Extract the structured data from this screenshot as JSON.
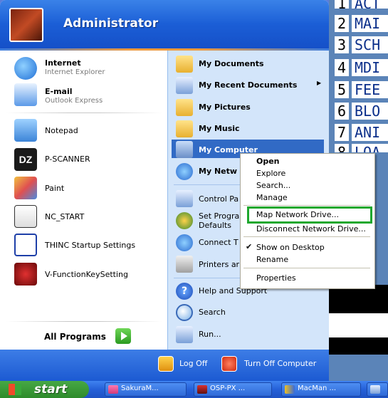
{
  "background_app": {
    "rows": [
      {
        "num": "1",
        "word": "ACT"
      },
      {
        "num": "2",
        "word": "MAI"
      },
      {
        "num": "3",
        "word": "SCH"
      },
      {
        "num": "4",
        "word": "MDI"
      },
      {
        "num": "5",
        "word": "FEE"
      },
      {
        "num": "6",
        "word": "BLO"
      },
      {
        "num": "7",
        "word": "ANI"
      },
      {
        "num": "8",
        "word": "LOA"
      }
    ]
  },
  "start_menu": {
    "user_name": "Administrator",
    "pinned": [
      {
        "label": "Internet",
        "sub": "Internet Explorer",
        "icon": "internet-explorer-icon"
      },
      {
        "label": "E-mail",
        "sub": "Outlook Express",
        "icon": "outlook-express-icon"
      }
    ],
    "recent": [
      {
        "label": "Notepad",
        "icon": "notepad-icon"
      },
      {
        "label": "P-SCANNER",
        "icon": "dz-icon"
      },
      {
        "label": "Paint",
        "icon": "paint-icon"
      },
      {
        "label": "NC_START",
        "icon": "nc-start-icon"
      },
      {
        "label": "THINC Startup Settings",
        "icon": "thinc-icon"
      },
      {
        "label": "V-FunctionKeySetting",
        "icon": "function-key-icon"
      }
    ],
    "all_programs": "All Programs",
    "places": [
      {
        "label": "My Documents",
        "icon": "my-documents-icon"
      },
      {
        "label": "My Recent Documents",
        "icon": "recent-documents-icon"
      },
      {
        "label": "My Pictures",
        "icon": "my-pictures-icon"
      },
      {
        "label": "My Music",
        "icon": "my-music-icon"
      },
      {
        "label": "My Computer",
        "icon": "my-computer-icon"
      },
      {
        "label": "My Netw",
        "icon": "my-network-icon"
      }
    ],
    "system": [
      {
        "label": "Control Pa",
        "icon": "control-panel-icon"
      },
      {
        "label": "Set Progra",
        "label2": "Defaults",
        "icon": "set-program-defaults-icon"
      },
      {
        "label": "Connect T",
        "icon": "connect-to-icon"
      },
      {
        "label": "Printers ar",
        "icon": "printers-icon"
      }
    ],
    "help": [
      {
        "label": "Help and Support",
        "icon": "help-icon"
      },
      {
        "label": "Search",
        "icon": "search-icon"
      },
      {
        "label": "Run...",
        "icon": "run-icon"
      }
    ],
    "log_off": "Log Off",
    "turn_off": "Turn Off Computer"
  },
  "context_menu": {
    "open": "Open",
    "explore": "Explore",
    "search": "Search...",
    "manage": "Manage",
    "map_network_drive": "Map Network Drive...",
    "disconnect_network_drive": "Disconnect Network Drive...",
    "show_on_desktop": "Show on Desktop",
    "rename": "Rename",
    "properties": "Properties"
  },
  "taskbar": {
    "start_label": "start",
    "tasks": [
      {
        "label": "SakuraM..."
      },
      {
        "label": "OSP-PX ..."
      },
      {
        "label": "MacMan ..."
      }
    ]
  },
  "colors": {
    "header_blue": "#1b5ed6",
    "highlight_blue": "#316ac5",
    "right_pane": "#d3e5fa",
    "annotation_green": "#1ea82e",
    "start_green": "#2e8b2b"
  }
}
